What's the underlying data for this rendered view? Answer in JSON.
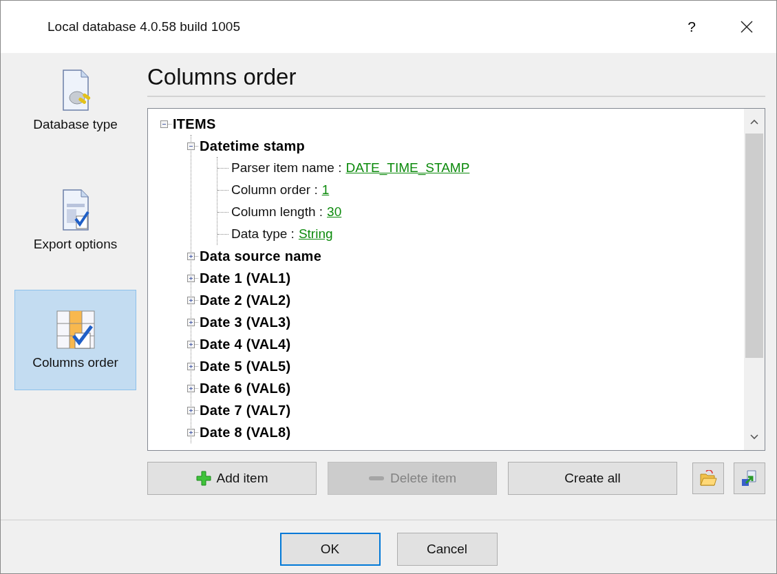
{
  "window": {
    "title": "Local database 4.0.58 build 1005",
    "help": "?"
  },
  "sidebar": {
    "items": [
      {
        "label": "Database type",
        "selected": false
      },
      {
        "label": "Export options",
        "selected": false
      },
      {
        "label": "Columns order",
        "selected": true
      }
    ]
  },
  "page_title": "Columns order",
  "tree": {
    "label": "ITEMS",
    "kind": "group",
    "expanded": true,
    "children": [
      {
        "label": "Datetime stamp",
        "kind": "group",
        "expanded": true,
        "children": [
          {
            "kind": "property",
            "label": "Parser item name :",
            "value": "DATE_TIME_STAMP"
          },
          {
            "kind": "property",
            "label": "Column order :",
            "value": "1"
          },
          {
            "kind": "property",
            "label": "Column length :",
            "value": "30"
          },
          {
            "kind": "property",
            "label": "Data type :",
            "value": "String"
          }
        ]
      },
      {
        "label": "Data source name",
        "kind": "group",
        "expanded": false
      },
      {
        "label": "Date 1 (VAL1)",
        "kind": "group",
        "expanded": false
      },
      {
        "label": "Date 2 (VAL2)",
        "kind": "group",
        "expanded": false
      },
      {
        "label": "Date 3 (VAL3)",
        "kind": "group",
        "expanded": false
      },
      {
        "label": "Date 4 (VAL4)",
        "kind": "group",
        "expanded": false
      },
      {
        "label": "Date 5 (VAL5)",
        "kind": "group",
        "expanded": false
      },
      {
        "label": "Date 6 (VAL6)",
        "kind": "group",
        "expanded": false
      },
      {
        "label": "Date 7 (VAL7)",
        "kind": "group",
        "expanded": false
      },
      {
        "label": "Date 8 (VAL8)",
        "kind": "group",
        "expanded": false
      }
    ]
  },
  "actions": [
    {
      "label": "Add item",
      "kind": "add",
      "disabled": false
    },
    {
      "label": "Delete item",
      "kind": "delete",
      "disabled": true
    },
    {
      "label": "Create all",
      "kind": "text",
      "disabled": false
    }
  ],
  "footer_buttons": [
    {
      "label": "OK",
      "default": true
    },
    {
      "label": "Cancel",
      "default": false
    }
  ]
}
